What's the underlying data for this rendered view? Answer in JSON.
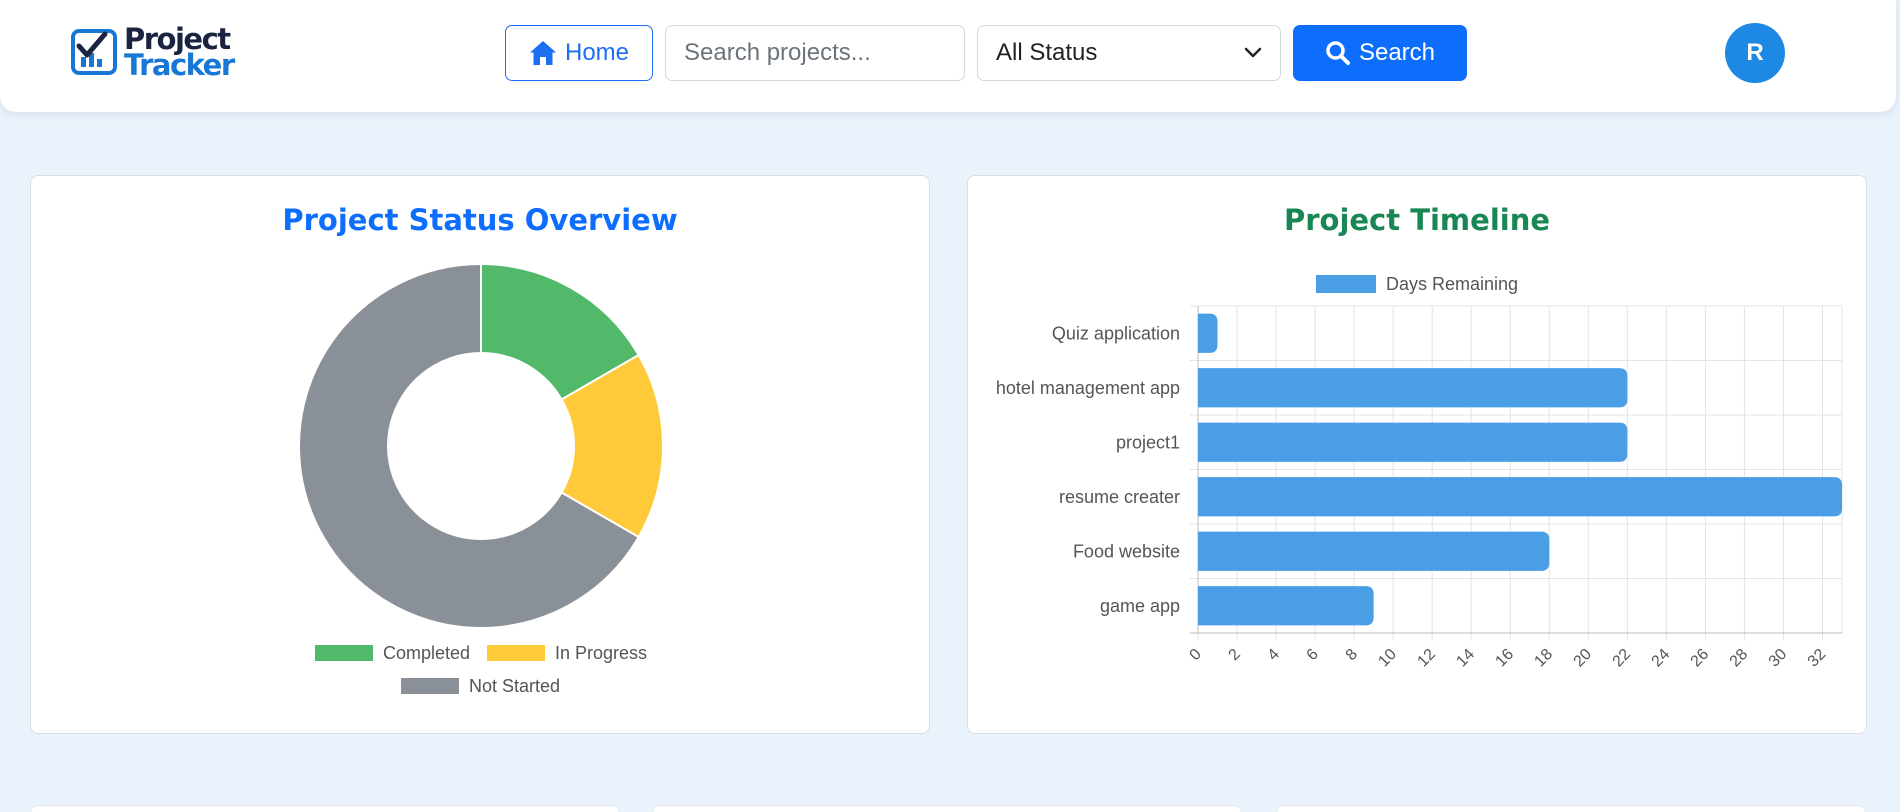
{
  "header": {
    "logo_line1": "Project",
    "logo_line2": "Tracker",
    "home_label": "Home",
    "search_placeholder": "Search projects...",
    "status_selected": "All Status",
    "search_button_label": "Search",
    "avatar_initial": "R"
  },
  "icons": {
    "home": "home-icon",
    "search": "search-icon",
    "dropdown": "chevron-down-icon",
    "logo": "checkbox-chart-icon"
  },
  "colors": {
    "primary": "#0d6efd",
    "completed": "#53b96a",
    "in_progress": "#ffca3a",
    "not_started": "#8a9097",
    "bar": "#4a9ee6",
    "timeline_title": "#198754"
  },
  "status_card": {
    "title": "Project Status Overview"
  },
  "timeline_card": {
    "title": "Project Timeline"
  },
  "chart_data": [
    {
      "type": "pie",
      "title": "Project Status Overview",
      "donut": true,
      "categories": [
        "Completed",
        "In Progress",
        "Not Started"
      ],
      "values": [
        1,
        1,
        4
      ],
      "colors": [
        "#53b96a",
        "#ffca3a",
        "#8a9097"
      ],
      "legend": "bottom"
    },
    {
      "type": "bar",
      "orientation": "horizontal",
      "title": "Project Timeline",
      "categories": [
        "Quiz application",
        "hotel management app",
        "project1",
        "resume creater",
        "Food website",
        "game app"
      ],
      "series": [
        {
          "name": "Days Remaining",
          "values": [
            1,
            22,
            22,
            33,
            18,
            9
          ],
          "color": "#4a9ee6"
        }
      ],
      "xlim": [
        0,
        33
      ],
      "xticks": [
        0,
        2,
        4,
        6,
        8,
        10,
        12,
        14,
        16,
        18,
        20,
        22,
        24,
        26,
        28,
        30,
        32
      ],
      "grid": true,
      "legend": "top"
    }
  ]
}
